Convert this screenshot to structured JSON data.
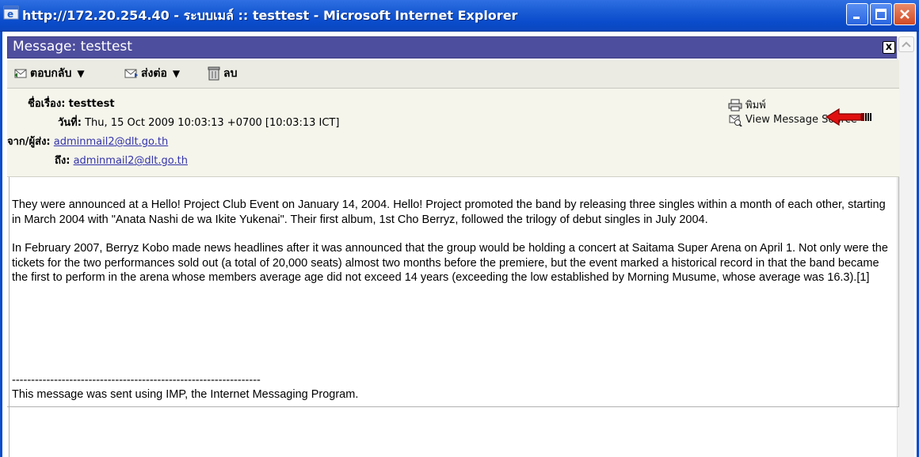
{
  "window": {
    "title": "http://172.20.254.40 - ระบบเมล์ :: testtest - Microsoft Internet Explorer",
    "titlebar_color": "#0a4ccc"
  },
  "message": {
    "header_label": "Message: testtest",
    "close_label": "x",
    "header_color": "#4e4e9e"
  },
  "toolbar": {
    "reply_label": "ตอบกลับ",
    "forward_label": "ส่งต่อ",
    "delete_label": "ลบ",
    "dropdown_glyph": "▼"
  },
  "headers": {
    "subject_key": "ชื่อเรื่อง:",
    "subject_value": "testtest",
    "date_key": "วันที่:",
    "date_value": "Thu, 15 Oct 2009 10:03:13 +0700 [10:03:13 ICT]",
    "from_key": "จาก/ผู้ส่ง:",
    "from_value": "adminmail2@dlt.go.th",
    "to_key": "ถึง:",
    "to_value": "adminmail2@dlt.go.th"
  },
  "actions": {
    "print_label": "พิมพ์",
    "view_source_label": "View Message Source"
  },
  "body": {
    "paragraph1": "They were announced at a Hello! Project Club Event on January 14, 2004. Hello! Project promoted the band by releasing three singles within a month of each other, starting in March 2004 with \"Anata Nashi de wa Ikite Yukenai\". Their first album, 1st Cho Berryz, followed the trilogy of debut singles in July 2004.",
    "paragraph2": "In February 2007, Berryz Kobo made news headlines after it was announced that the group would be holding a concert at Saitama Super Arena on April 1. Not only were the tickets for the two performances sold out (a total of 20,000 seats) almost two months before the premiere, but the event marked a historical record in that the band became the first to perform in the arena whose members average age did not exceed 14 years (exceeding the low established by Morning Musume, whose average was 16.3).[1]",
    "separator": "-----------------------------------------------------------------",
    "signature": "This message was sent using IMP, the Internet Messaging Program."
  },
  "icons": {
    "app": "ie-icon",
    "reply": "reply-icon",
    "forward": "forward-icon",
    "delete": "trash-icon",
    "print": "printer-icon",
    "source": "view-source-icon",
    "annotation": "red-arrow-icon"
  }
}
